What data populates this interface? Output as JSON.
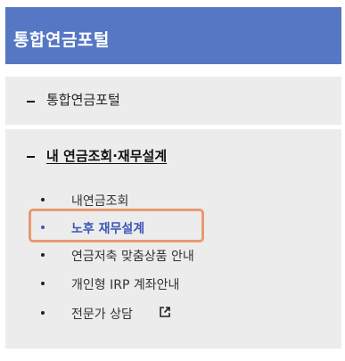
{
  "header": {
    "title": "통합연금포털"
  },
  "nav": {
    "portal_label": "통합연금포털",
    "category": {
      "label": "내 연금조회·재무설계",
      "items": [
        {
          "label": "내연금조회",
          "active": false
        },
        {
          "label": "노후 재무설계",
          "active": true
        },
        {
          "label": "연금저축 맞춤상품 안내",
          "active": false
        },
        {
          "label": "개인형 IRP 계좌안내",
          "active": false
        },
        {
          "label": "전문가 상담",
          "active": false,
          "icon": "external-link-icon"
        }
      ]
    }
  },
  "colors": {
    "header_bg": "#5678c4",
    "section_bg": "#ececec",
    "active_text": "#3c56b8",
    "highlight_border": "#e89a6f"
  }
}
